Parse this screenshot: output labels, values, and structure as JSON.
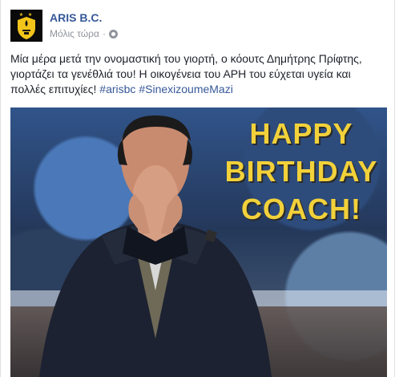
{
  "post": {
    "page_name": "ARIS B.C.",
    "timestamp": "Μόλις τώρα",
    "separator": "·",
    "message_text": "Μία μέρα μετά την ονομαστική του γιορτή, ο κόουτς Δημήτρης Πρίφτης, γιορτάζει τα γενέθλιά του! Η οικογένεια του ΑΡΗ του εύχεται υγεία και πολλές επιτυχίες! ",
    "hashtags": [
      "#arisbc",
      "#SinexizoumeMazi"
    ],
    "image_text": [
      "HAPPY",
      "BIRTHDAY",
      "COACH!"
    ]
  },
  "icons": {
    "avatar": "aris-logo-icon",
    "privacy": "globe-icon"
  },
  "colors": {
    "link": "#365899",
    "meta": "#90949c",
    "text": "#1d2129",
    "gold": "#f2d13a"
  }
}
